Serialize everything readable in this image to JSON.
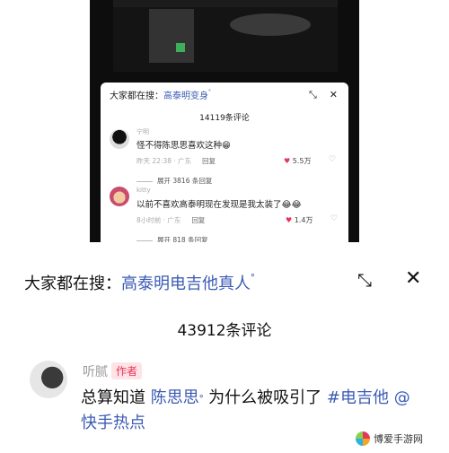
{
  "small_panel": {
    "search_prefix": "大家都在搜：",
    "search_term": "高泰明变身",
    "search_glyph": "ᐤ",
    "comment_count": "14119条评论",
    "comments": [
      {
        "name": "宁明",
        "text": "怪不得陈思思喜欢这种😁",
        "time": "昨天 22:38 · 广东",
        "reply": "回复",
        "likes": "5.5万"
      },
      {
        "name": "kitty",
        "text": "以前不喜欢高泰明现在发现是我太装了😂😂",
        "time": "8小时前 · 广东",
        "reply": "回复",
        "likes": "1.4万"
      }
    ],
    "expand_1": "展开 3816 条回复",
    "expand_2": "展开 818 条回复"
  },
  "big_panel": {
    "search_prefix": "大家都在搜：",
    "search_term": "高泰明电吉他真人",
    "search_glyph": "ᐤ",
    "comment_count": "43912条评论",
    "comment": {
      "name": "听腻",
      "badge": "作者",
      "text_part1": "总算知道 ",
      "text_link1": "陈思思",
      "text_part2": " 为什么被吸引了 ",
      "text_link2": "#电吉他",
      "text_part3": " ",
      "text_link3": "@快手热点"
    }
  },
  "watermark": "博爱手游网",
  "icons": [
    "expand-icon",
    "close-icon",
    "heart-icon",
    "dislike-icon",
    "search-glyph-icon"
  ],
  "colors": {
    "link": "#3b5bb4",
    "like": "#e8345a",
    "badge_bg": "#ffe3e6"
  }
}
